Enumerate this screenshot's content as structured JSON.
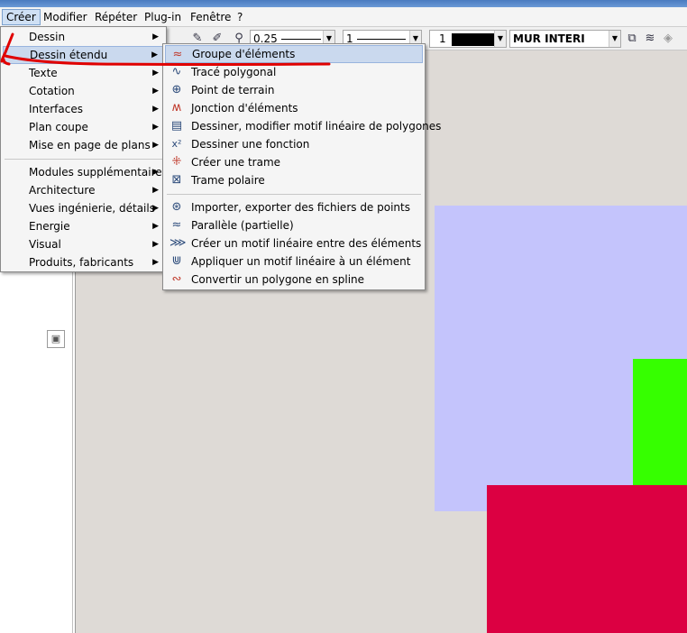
{
  "menubar": {
    "items": [
      {
        "label": "Créer",
        "active": true
      },
      {
        "label": "Modifier"
      },
      {
        "label": "Répéter"
      },
      {
        "label": "Plug-in"
      },
      {
        "label": "Fenêtre"
      },
      {
        "label": "?"
      }
    ]
  },
  "toolbar": {
    "pen_value": "0.25",
    "line_value": "1",
    "color_value": "1",
    "layer_value": "MUR INTERI",
    "icons": [
      "pencil-icon",
      "eyedropper-icon",
      "layers-icon",
      "layer-stack-icon",
      "layer-disabled-icon"
    ]
  },
  "menu_creer": {
    "items": [
      {
        "label": "Dessin",
        "has_sub": true
      },
      {
        "label": "Dessin étendu",
        "has_sub": true,
        "highlighted": true
      },
      {
        "label": "Texte",
        "has_sub": true
      },
      {
        "label": "Cotation",
        "has_sub": true
      },
      {
        "label": "Interfaces",
        "has_sub": true
      },
      {
        "label": "Plan coupe",
        "has_sub": true
      },
      {
        "label": "Mise en page de plans",
        "has_sub": true
      },
      {
        "label": "Modules supplémentaires",
        "has_sub": true
      },
      {
        "label": "Architecture",
        "has_sub": true
      },
      {
        "label": "Vues ingénierie, détails",
        "has_sub": true
      },
      {
        "label": "Energie",
        "has_sub": true
      },
      {
        "label": "Visual",
        "has_sub": true
      },
      {
        "label": "Produits, fabricants",
        "has_sub": true
      }
    ]
  },
  "menu_dessin_etendu": {
    "items": [
      {
        "label": "Groupe d'éléments",
        "icon": "element-group-icon",
        "highlighted": true
      },
      {
        "label": "Tracé polygonal",
        "icon": "polyline-icon"
      },
      {
        "label": "Point de terrain",
        "icon": "terrain-point-icon"
      },
      {
        "label": "Jonction d'éléments",
        "icon": "element-junction-icon"
      },
      {
        "label": "Dessiner, modifier motif linéaire de polygones",
        "icon": "linear-pattern-icon"
      },
      {
        "label": "Dessiner une fonction",
        "icon": "function-icon"
      },
      {
        "label": "Créer une trame",
        "icon": "grid-icon"
      },
      {
        "label": "Trame polaire",
        "icon": "polar-grid-icon"
      },
      {
        "label": "Importer, exporter des fichiers de points",
        "icon": "import-export-points-icon"
      },
      {
        "label": "Parallèle (partielle)",
        "icon": "parallel-icon"
      },
      {
        "label": "Créer un motif linéaire entre des éléments",
        "icon": "linear-pattern-between-icon"
      },
      {
        "label": "Appliquer un motif linéaire à un élément",
        "icon": "apply-linear-pattern-icon"
      },
      {
        "label": "Convertir un polygone en spline",
        "icon": "polygon-to-spline-icon"
      }
    ]
  },
  "colors": {
    "lavender_shape": "#c4c4fc",
    "green_shape": "#36ff00",
    "crimson_shape": "#dc0042",
    "annotation_red": "#e00000",
    "highlight": "#cad9ee"
  }
}
